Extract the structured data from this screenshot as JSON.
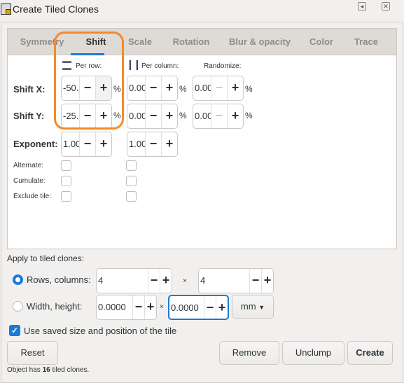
{
  "window": {
    "title": "Create Tiled Clones"
  },
  "tabs": [
    {
      "label": "Symmetry"
    },
    {
      "label": "Shift",
      "active": true
    },
    {
      "label": "Scale"
    },
    {
      "label": "Rotation"
    },
    {
      "label": "Blur & opacity"
    },
    {
      "label": "Color"
    },
    {
      "label": "Trace"
    }
  ],
  "shift": {
    "headers": {
      "per_row": "Per row:",
      "per_column": "Per column:",
      "randomize": "Randomize:"
    },
    "shift_x": {
      "label": "Shift X:",
      "per_row": "-50.000",
      "per_column": "0.000",
      "randomize": "0.000",
      "unit": "%"
    },
    "shift_y": {
      "label": "Shift Y:",
      "per_row": "-25.000",
      "per_column": "0.000",
      "randomize": "0.000",
      "unit": "%"
    },
    "exponent": {
      "label": "Exponent:",
      "per_row": "1.000",
      "per_column": "1.000"
    },
    "alternate": {
      "label": "Alternate:"
    },
    "cumulate": {
      "label": "Cumulate:"
    },
    "exclude_tile": {
      "label": "Exclude tile:"
    }
  },
  "apply": {
    "heading": "Apply to tiled clones:",
    "rows_columns": {
      "label": "Rows, columns:",
      "rows": "4",
      "columns": "4",
      "selected": true
    },
    "width_height": {
      "label": "Width, height:",
      "width": "0.0000",
      "height": "0.0000",
      "unit": "mm",
      "selected": false
    },
    "times": "×",
    "use_saved": {
      "label": "Use saved size and position of the tile",
      "checked": true
    }
  },
  "buttons": {
    "reset": "Reset",
    "remove": "Remove",
    "unclump": "Unclump",
    "create": "Create"
  },
  "status": {
    "prefix": "Object has ",
    "count": "16",
    "suffix": " tiled clones."
  },
  "spin": {
    "minus": "−",
    "plus": "+"
  },
  "colors": {
    "accent": "#1a7ad6",
    "highlight": "#f5892a"
  }
}
